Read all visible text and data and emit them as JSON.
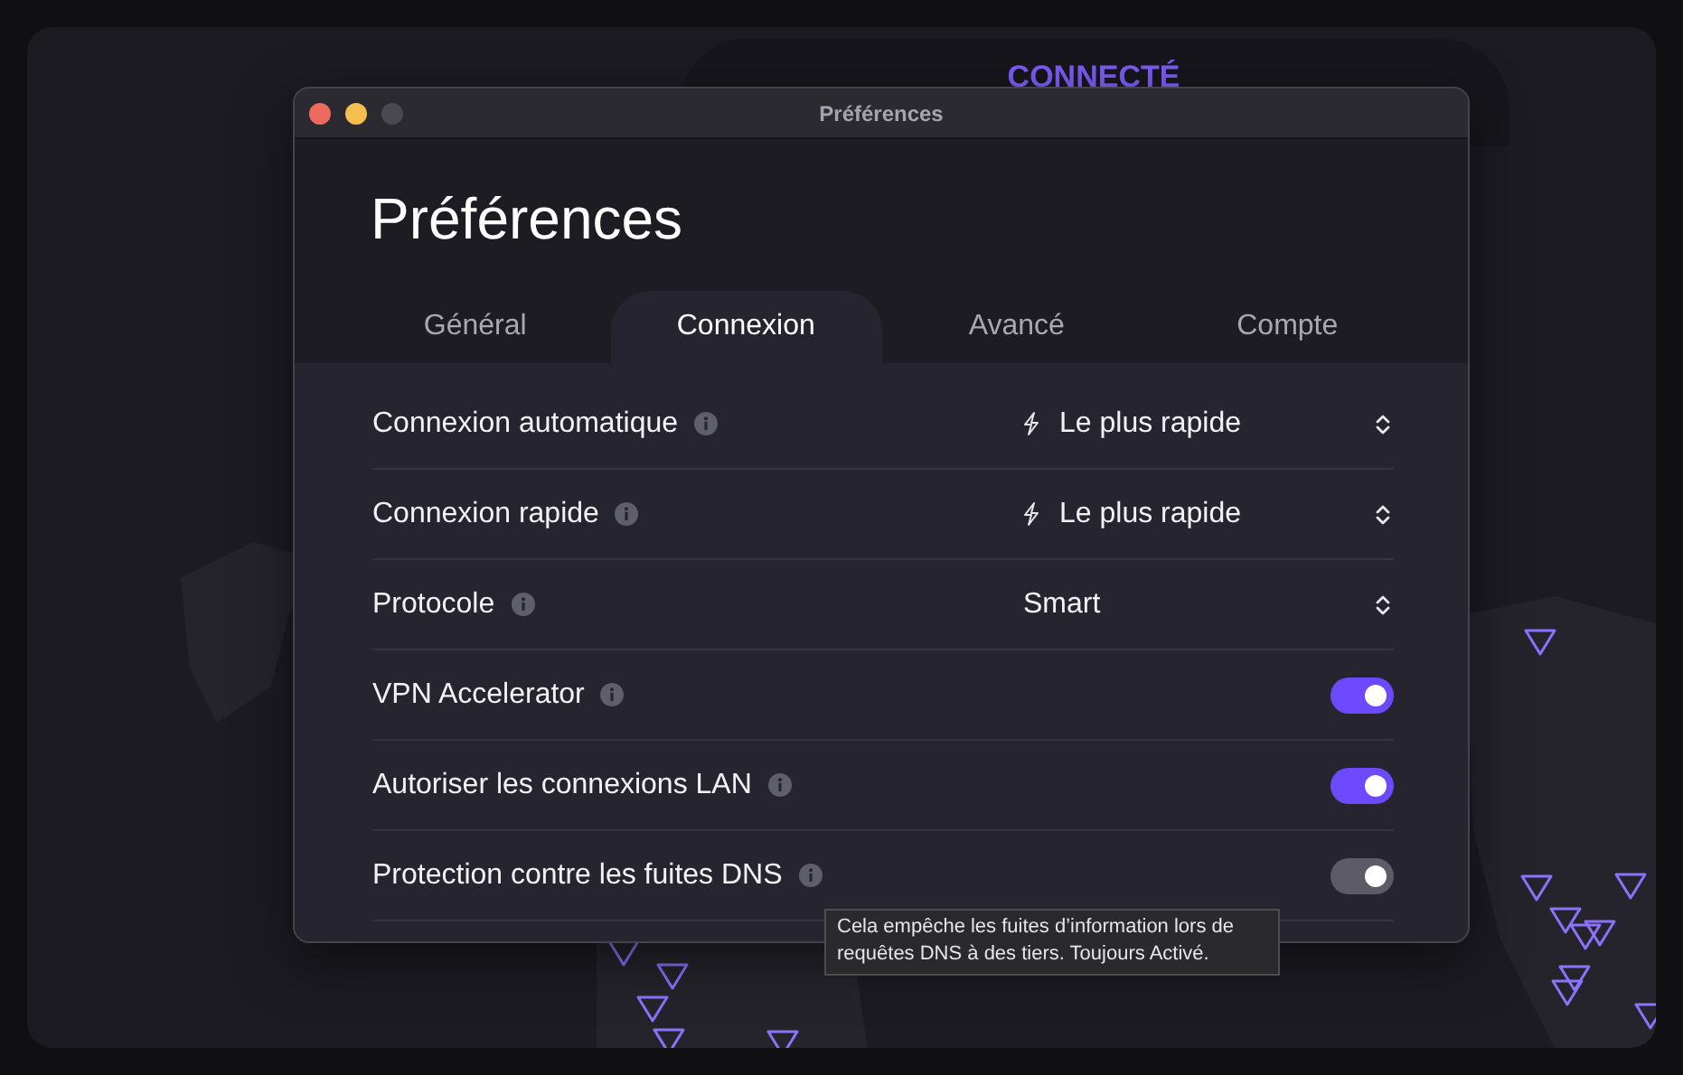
{
  "app": {
    "status": "CONNECTÉ"
  },
  "window": {
    "title": "Préférences",
    "heading": "Préférences",
    "controls": [
      {
        "kind": "close",
        "disabled": false
      },
      {
        "kind": "minimize",
        "disabled": false
      },
      {
        "kind": "zoom",
        "disabled": true
      }
    ]
  },
  "tabs": [
    {
      "label": "Général",
      "selected": false
    },
    {
      "label": "Connexion",
      "selected": true
    },
    {
      "label": "Avancé",
      "selected": false
    },
    {
      "label": "Compte",
      "selected": false
    }
  ],
  "settings": [
    {
      "label": "Connexion automatique",
      "kind": "select",
      "value": "Le plus rapide",
      "bolt": true
    },
    {
      "label": "Connexion rapide",
      "kind": "select",
      "value": "Le plus rapide",
      "bolt": true
    },
    {
      "label": "Protocole",
      "kind": "select",
      "value": "Smart",
      "bolt": false
    },
    {
      "label": "VPN Accelerator",
      "kind": "toggle",
      "on": true,
      "disabled": false
    },
    {
      "label": "Autoriser les connexions LAN",
      "kind": "toggle",
      "on": true,
      "disabled": false
    },
    {
      "label": "Protection contre les fuites DNS",
      "kind": "toggle",
      "on": true,
      "disabled": true
    }
  ],
  "tooltip": {
    "text": "Cela empêche les fuites d’information lors de requêtes DNS à des tiers. Toujours Activé."
  }
}
